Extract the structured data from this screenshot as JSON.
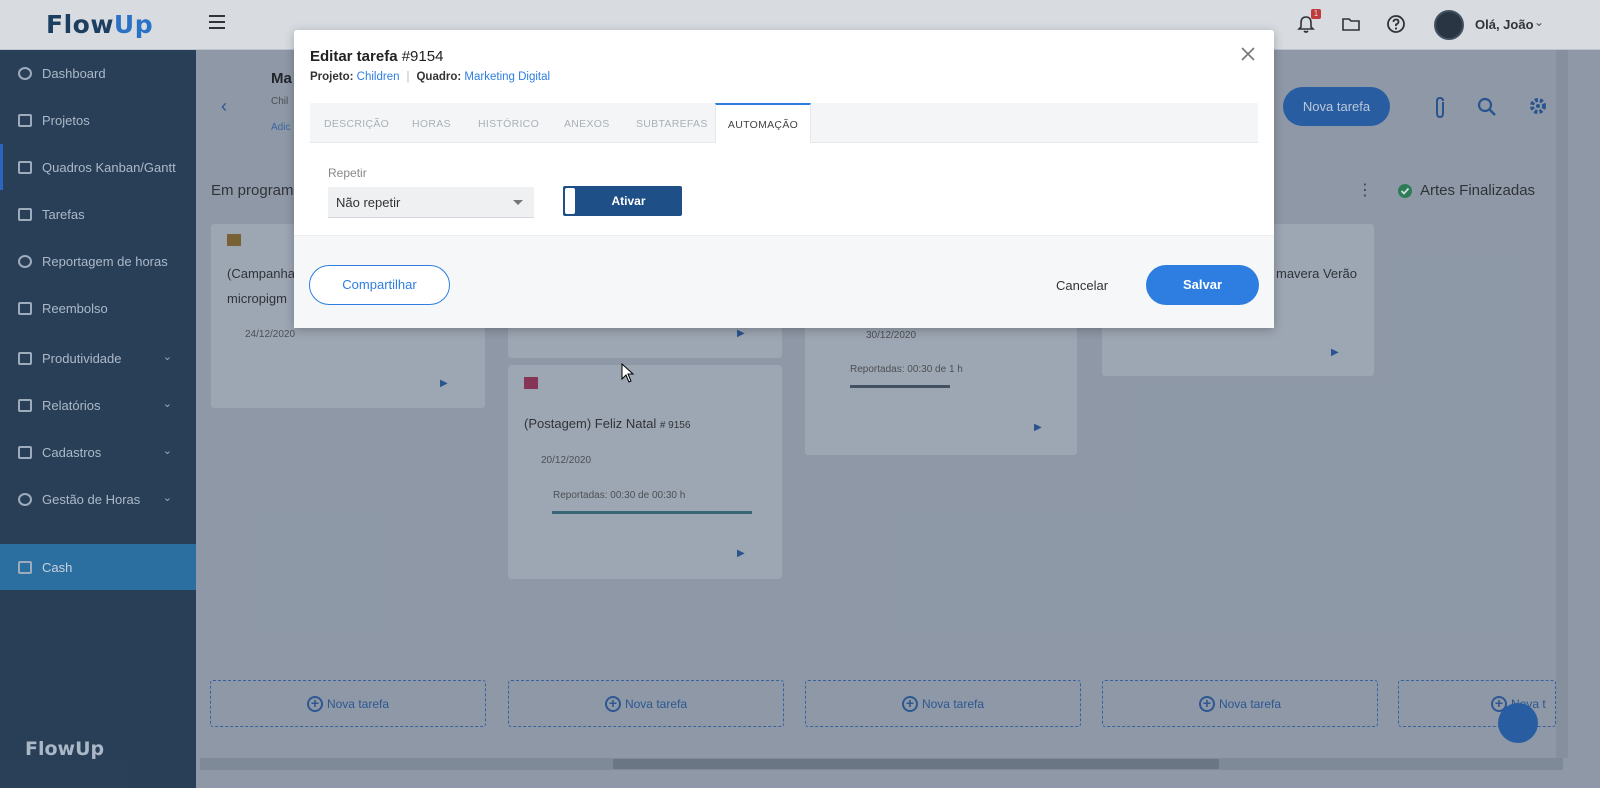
{
  "app": {
    "logo_text": "FlowUp",
    "notification_count": "1",
    "greeting": "Olá, João"
  },
  "sidebar": {
    "items": [
      {
        "label": "Dashboard"
      },
      {
        "label": "Projetos"
      },
      {
        "label": "Quadros Kanban/Gantt"
      },
      {
        "label": "Tarefas"
      },
      {
        "label": "Reportagem de horas"
      },
      {
        "label": "Reembolso"
      },
      {
        "label": "Produtividade"
      },
      {
        "label": "Relatórios"
      },
      {
        "label": "Cadastros"
      },
      {
        "label": "Gestão de Horas"
      },
      {
        "label": "Cash"
      }
    ],
    "footer_logo": "FlowUp"
  },
  "board": {
    "title": "Ma",
    "subtitle": "Chil",
    "sub_link": "Adic",
    "new_task_top": "Nova tarefa",
    "columns": [
      {
        "title": "Em program"
      },
      {
        "title": ""
      },
      {
        "title": ""
      },
      {
        "title": ""
      },
      {
        "title": "Artes Finalizadas"
      }
    ],
    "cards": {
      "c1_title_line1": "(Campanha",
      "c1_title_line2": "micropigm",
      "c1_date": "24/12/2020",
      "c2_title": "(Postagem) Feliz Natal",
      "c2_id": "# 9156",
      "c2_date": "20/12/2020",
      "c2_report": "Reportadas: 00:30 de 00:30 h",
      "c3_date": "30/12/2020",
      "c3_report": "Reportadas: 00:30 de 1 h",
      "c4_title": "mavera Verão"
    },
    "new_task_label": "Nova tarefa",
    "new_task_partial": "Nova t"
  },
  "modal": {
    "title_prefix": "Editar tarefa",
    "task_id": "#9154",
    "project_label": "Projeto:",
    "project_value": "Children",
    "board_label": "Quadro:",
    "board_value": "Marketing Digital",
    "tabs": [
      {
        "label": "DESCRIÇÃO"
      },
      {
        "label": "HORAS"
      },
      {
        "label": "HISTÓRICO"
      },
      {
        "label": "ANEXOS"
      },
      {
        "label": "SUBTAREFAS"
      },
      {
        "label": "AUTOMAÇÃO"
      }
    ],
    "active_tab": "AUTOMAÇÃO",
    "repeat_label": "Repetir",
    "repeat_value": "Não repetir",
    "toggle_label": "Ativar",
    "share_label": "Compartilhar",
    "cancel_label": "Cancelar",
    "save_label": "Salvar"
  },
  "colors": {
    "accent": "#2d7ee0",
    "sidebar_bg": "#2a4058",
    "toggle_bg": "#1e4f86"
  }
}
